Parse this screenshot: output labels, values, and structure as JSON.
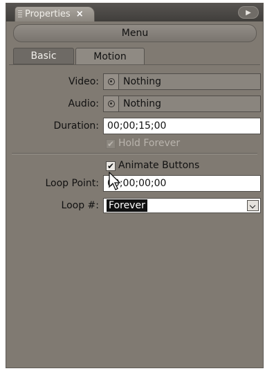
{
  "panel": {
    "tab_title": "Properties",
    "close_symbol": "×",
    "menu_symbol": "▶"
  },
  "menu_bar": {
    "label": "Menu"
  },
  "tabs": [
    {
      "label": "Basic",
      "active": false
    },
    {
      "label": "Motion",
      "active": true
    }
  ],
  "fields": {
    "video": {
      "label": "Video:",
      "value": "Nothing"
    },
    "audio": {
      "label": "Audio:",
      "value": "Nothing"
    },
    "duration": {
      "label": "Duration:",
      "value": "00;00;15;00"
    },
    "hold_forever": {
      "label": "Hold Forever",
      "checked": true,
      "disabled": true
    },
    "animate_buttons": {
      "label": "Animate Buttons",
      "checked": true
    },
    "loop_point": {
      "label": "Loop Point:",
      "value": "00;00;00;00"
    },
    "loop_count": {
      "label": "Loop #:",
      "value": "Forever"
    }
  },
  "icons": {
    "asset_picker": "pickwhip-icon",
    "checkmark": "✔"
  },
  "colors": {
    "panel_bg": "#807a72",
    "titlebar": "#403e3b",
    "tab_active": "#8f8a83",
    "input_bg": "#ffffff"
  }
}
